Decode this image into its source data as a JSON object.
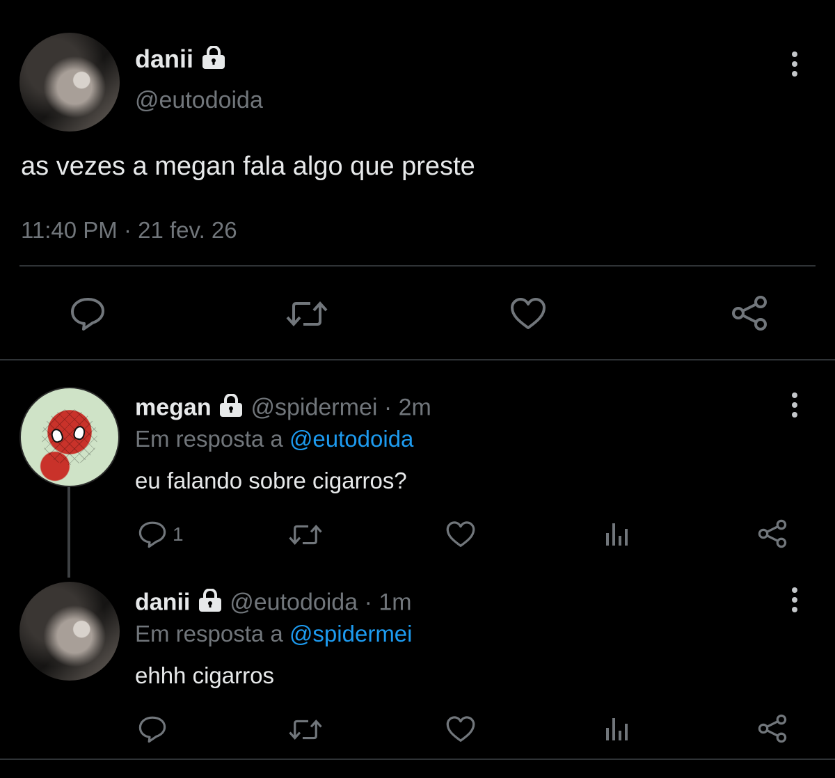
{
  "main_tweet": {
    "display_name": "danii",
    "handle": "@eutodoida",
    "text": "as vezes a megan fala algo que preste",
    "timestamp": "11:40 PM · 21 fev. 26"
  },
  "replies": [
    {
      "display_name": "megan",
      "handle": "@spidermei",
      "time": "· 2m",
      "reply_prefix": "Em resposta a",
      "reply_to": "@eutodoida",
      "text": "eu falando sobre cigarros?",
      "reply_count": "1"
    },
    {
      "display_name": "danii",
      "handle": "@eutodoida",
      "time": "· 1m",
      "reply_prefix": "Em resposta a",
      "reply_to": "@spidermei",
      "text": "ehhh cigarros",
      "reply_count": ""
    }
  ],
  "icons": {
    "lock": "lock-icon",
    "reply": "speech-bubble-icon",
    "retweet": "retweet-icon",
    "like": "heart-icon",
    "views": "bar-chart-icon",
    "share": "share-icon",
    "more": "vertical-ellipsis-icon"
  },
  "colors": {
    "background": "#000000",
    "text": "#e7e9ea",
    "muted": "#71767b",
    "link": "#1d9bf0",
    "divider": "#2f3336"
  }
}
